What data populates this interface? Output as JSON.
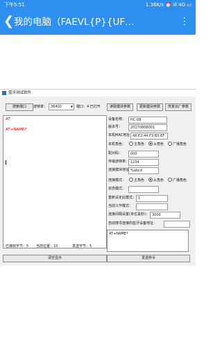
{
  "statusbar": {
    "time": "下午5:51",
    "right": "1.36K/s ⏰ ıll 4G ▭"
  },
  "navbar": {
    "title": "我的电脑（FAEVL{P}{UF…",
    "more_icon": "more-icon"
  },
  "app": {
    "title": "蓝牙测试软件",
    "toolbar": {
      "search_button": "搜索端口",
      "baud_label": "波特率：",
      "baud_value": "38400",
      "port_label": "端口：4 已打开",
      "read_params_button": "读取模块参数",
      "update_params_button": "更新模块参数",
      "restore_button": "恢复出厂参数"
    },
    "log": {
      "line1": "AT",
      "line2": "AT+NAME?"
    },
    "fields": {
      "device_name_label": "设备名称：",
      "device_name": "HC-08",
      "version_label": "版本号：",
      "version": "20170808001",
      "mac_label": "本机MAC地址：",
      "mac": "48:E2:44:F3:B3:EF",
      "role_label": "本机角色：",
      "role_master": "主角色",
      "role_slave": "从角色",
      "role_broadcast": "广播角色",
      "pin_label": "配对码：",
      "pin": "000",
      "baud_label": "传输波特率：",
      "baud": "1234",
      "bt_addr_label": "连接模块地址：",
      "bt_addr": "%abcd",
      "conn_mode_label": "连接模式：",
      "conn_master": "主角色",
      "conn_slave": "从角色",
      "conn_broadcast": "广播角色",
      "state_label": "状态模式：",
      "reconnect_label": "重新设定此模式：",
      "reconnect": "1",
      "work_label": "当前工作模式：",
      "interval_label": "连接间隔设置(单位毫秒)：",
      "interval": "3000",
      "search_label": "自动搜寻连接的蓝牙设备地址："
    },
    "counters": {
      "received": "已接收字节：5",
      "current": "当前位置：10",
      "sent": "发送字节：5"
    },
    "send_text": "AT+NAME?",
    "clear_button": "清空显示",
    "send_button": "发送命令"
  }
}
